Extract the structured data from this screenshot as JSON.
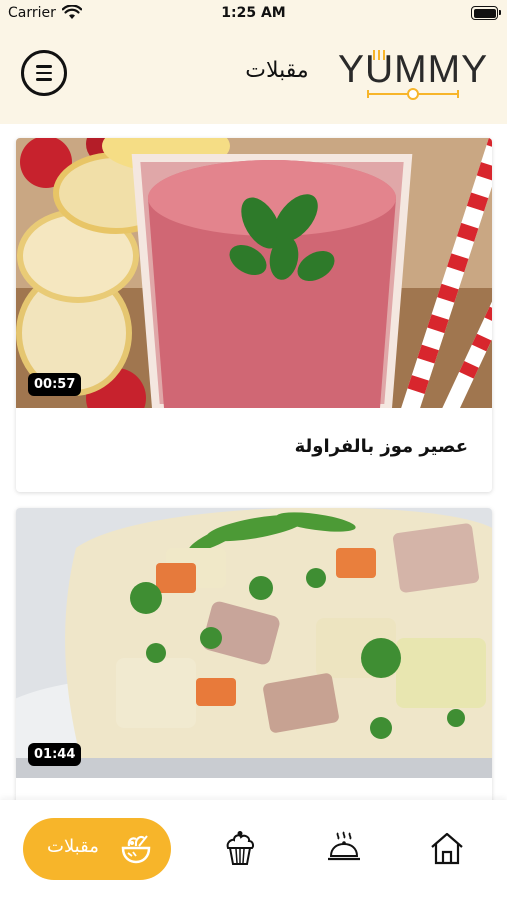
{
  "status_bar": {
    "carrier": "Carrier",
    "time": "1:25 AM"
  },
  "header": {
    "title": "مقبلات",
    "logo_text": "YUMMY",
    "menu_icon": "hamburger-menu-icon"
  },
  "cards": [
    {
      "duration": "00:57",
      "title": "عصير موز بالفراولة"
    },
    {
      "duration": "01:44",
      "title": ""
    }
  ],
  "bottom_nav": {
    "active_label": "مقبلات",
    "items": [
      "salad-bowl-icon",
      "cupcake-icon",
      "covered-dish-icon",
      "home-icon"
    ]
  },
  "colors": {
    "header_bg": "#fbf5e6",
    "accent": "#f7b52a",
    "logo_underline": "#f7b52a"
  }
}
